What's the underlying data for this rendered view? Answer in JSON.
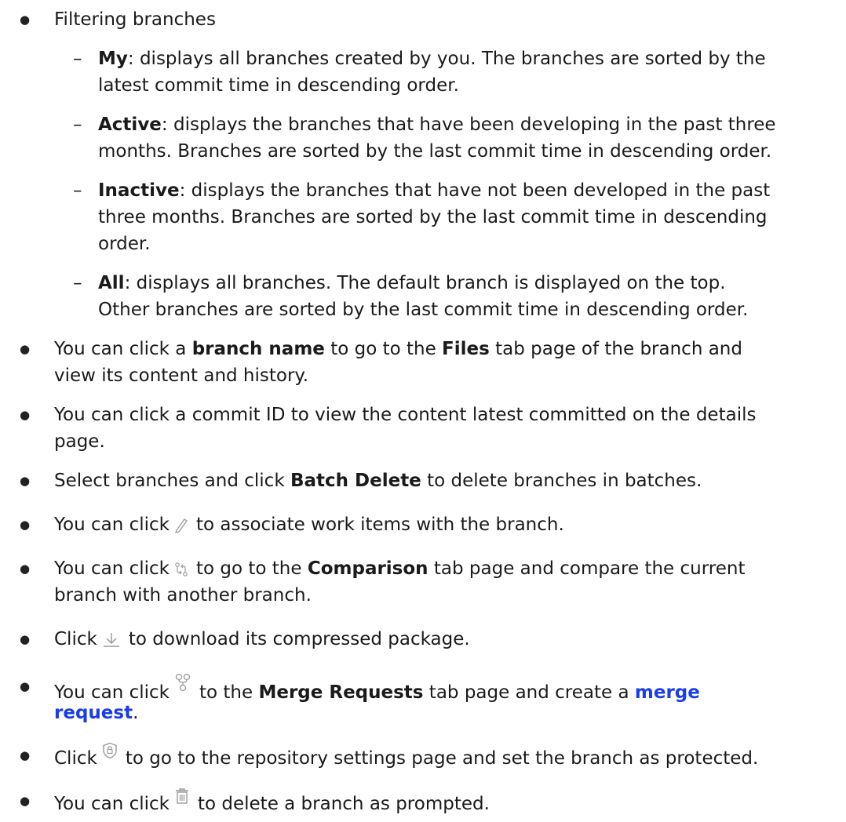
{
  "bullets": {
    "dot": "●",
    "dash": "–"
  },
  "filtering": {
    "title": "Filtering branches",
    "my": {
      "term": "My",
      "line1": ": displays all branches created by you. The branches are sorted by the",
      "line2": "latest commit time in descending order."
    },
    "active": {
      "term": "Active",
      "line1": ": displays the branches that have been developing in the past three",
      "line2": "months. Branches are sorted by the last commit time in descending order."
    },
    "inactive": {
      "term": "Inactive",
      "line1": ": displays the branches that have not been developed in the past",
      "line2": "three months. Branches are sorted by the last commit time in descending",
      "line3": "order."
    },
    "all": {
      "term": "All",
      "line1": ": displays all branches. The default branch is displayed on the top.",
      "line2": "Other branches are sorted by the last commit time in descending order."
    }
  },
  "branch_name": {
    "pre": "You can click a ",
    "bold1": "branch name",
    "mid": " to go to the ",
    "bold2": "Files",
    "post": " tab page of the branch and",
    "line2": "view its content and history."
  },
  "commit_id": {
    "line1": "You can click a commit ID to view the content latest committed on the details",
    "line2": "page."
  },
  "batch_delete": {
    "pre": "Select branches and click ",
    "bold": "Batch Delete",
    "post": " to delete branches in batches."
  },
  "associate": {
    "pre": "You can click",
    "post": "to associate work items with the branch.",
    "icon": "edit-pencil-icon"
  },
  "compare": {
    "pre": "You can click",
    "mid": "to go to the ",
    "bold": "Comparison",
    "post": " tab page and compare the current",
    "line2": "branch with another branch.",
    "icon": "compare-icon"
  },
  "download": {
    "pre": "Click",
    "post": "to download its compressed package.",
    "icon": "download-icon"
  },
  "merge": {
    "pre": "You can click",
    "mid": "to the ",
    "bold": "Merge Requests",
    "post": " tab page and create a ",
    "link1": "merge",
    "link2": "request",
    "end": ".",
    "icon": "merge-request-icon"
  },
  "protect": {
    "pre": "Click",
    "post": "to go to the repository settings page and set the branch as protected.",
    "icon": "shield-icon"
  },
  "delete": {
    "pre": "You can click",
    "post": "to delete a branch as prompted.",
    "icon": "trash-icon"
  },
  "colors": {
    "text": "#1a1a1a",
    "link": "#1a3de8",
    "icon": "#9a9a9a"
  }
}
